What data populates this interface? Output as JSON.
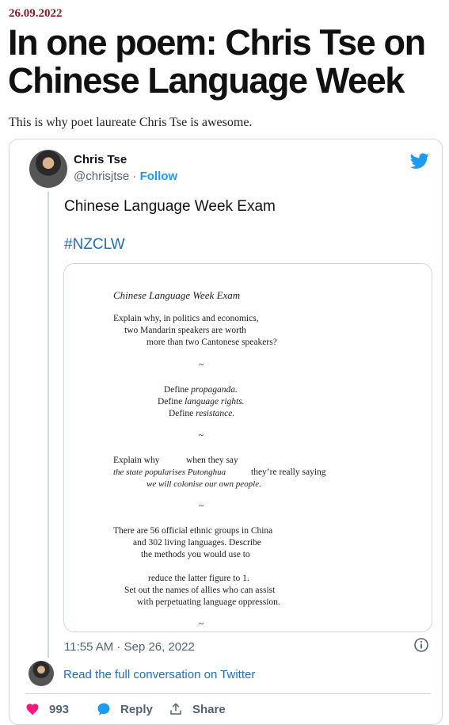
{
  "article": {
    "date": "26.09.2022",
    "headline": "In one poem: Chris Tse on Chinese Language Week",
    "intro": "This is why poet laureate Chris Tse is awesome."
  },
  "tweet": {
    "author_name": "Chris Tse",
    "handle": "@chrisjtse",
    "separator": " · ",
    "follow_label": "Follow",
    "text": "Chinese Language Week Exam",
    "hashtag": "#NZCLW",
    "timestamp": "11:55 AM · Sep 26, 2022",
    "read_full_label": "Read the full conversation on Twitter",
    "likes": "993",
    "reply_label": "Reply",
    "share_label": "Share"
  },
  "poem": {
    "title": "Chinese Language Week Exam",
    "l1": "Explain why, in politics and economics,",
    "l2": "two Mandarin speakers are worth",
    "l3": "more than two Cantonese speakers?",
    "sep": "~",
    "l4a": "Define ",
    "l4b": "propaganda.",
    "l5a": "Define ",
    "l5b": "language rights.",
    "l6a": "Define ",
    "l6b": "resistance.",
    "l7a": "Explain why",
    "l7b": "when they say",
    "l8a": "the state popularises Putonghua",
    "l8b": "they’re really saying",
    "l9": "we will colonise our own people.",
    "l10": "There are 56 official ethnic groups in China",
    "l11": "and 302 living languages. Describe",
    "l12": "the methods you would use to",
    "l13": "reduce the latter figure to 1.",
    "l14": "Set out the names of allies who can assist",
    "l15": "with perpetuating language oppression."
  },
  "colors": {
    "date": "#8b1a2b",
    "link": "#1d6fc0",
    "twitter_blue": "#1d9bf0",
    "like_pink": "#f91880",
    "muted": "#536471"
  },
  "icons": [
    "twitter-bird-icon",
    "info-icon",
    "heart-icon",
    "reply-bubble-icon",
    "share-icon"
  ]
}
